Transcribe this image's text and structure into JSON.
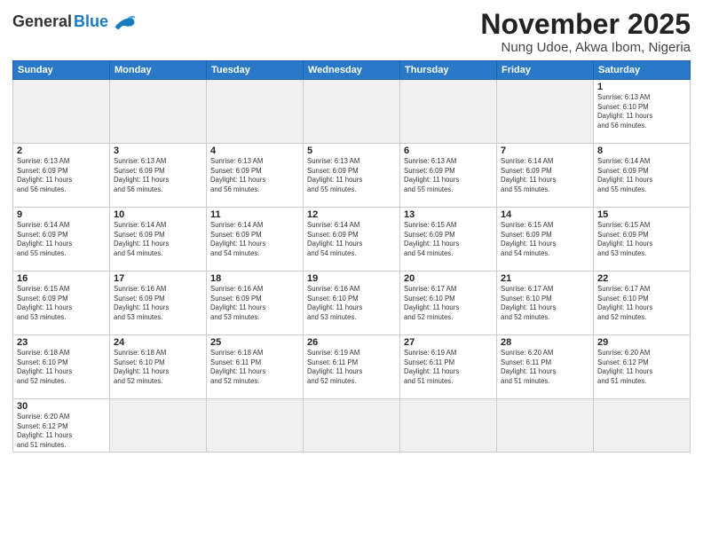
{
  "header": {
    "logo_general": "General",
    "logo_blue": "Blue",
    "month_title": "November 2025",
    "subtitle": "Nung Udoe, Akwa Ibom, Nigeria"
  },
  "weekdays": [
    "Sunday",
    "Monday",
    "Tuesday",
    "Wednesday",
    "Thursday",
    "Friday",
    "Saturday"
  ],
  "days": [
    {
      "date": 1,
      "sunrise": "6:13 AM",
      "sunset": "6:10 PM",
      "daylight": "11 hours and 56 minutes."
    },
    {
      "date": 2,
      "sunrise": "6:13 AM",
      "sunset": "6:09 PM",
      "daylight": "11 hours and 56 minutes."
    },
    {
      "date": 3,
      "sunrise": "6:13 AM",
      "sunset": "6:09 PM",
      "daylight": "11 hours and 56 minutes."
    },
    {
      "date": 4,
      "sunrise": "6:13 AM",
      "sunset": "6:09 PM",
      "daylight": "11 hours and 56 minutes."
    },
    {
      "date": 5,
      "sunrise": "6:13 AM",
      "sunset": "6:09 PM",
      "daylight": "11 hours and 55 minutes."
    },
    {
      "date": 6,
      "sunrise": "6:13 AM",
      "sunset": "6:09 PM",
      "daylight": "11 hours and 55 minutes."
    },
    {
      "date": 7,
      "sunrise": "6:14 AM",
      "sunset": "6:09 PM",
      "daylight": "11 hours and 55 minutes."
    },
    {
      "date": 8,
      "sunrise": "6:14 AM",
      "sunset": "6:09 PM",
      "daylight": "11 hours and 55 minutes."
    },
    {
      "date": 9,
      "sunrise": "6:14 AM",
      "sunset": "6:09 PM",
      "daylight": "11 hours and 55 minutes."
    },
    {
      "date": 10,
      "sunrise": "6:14 AM",
      "sunset": "6:09 PM",
      "daylight": "11 hours and 54 minutes."
    },
    {
      "date": 11,
      "sunrise": "6:14 AM",
      "sunset": "6:09 PM",
      "daylight": "11 hours and 54 minutes."
    },
    {
      "date": 12,
      "sunrise": "6:14 AM",
      "sunset": "6:09 PM",
      "daylight": "11 hours and 54 minutes."
    },
    {
      "date": 13,
      "sunrise": "6:15 AM",
      "sunset": "6:09 PM",
      "daylight": "11 hours and 54 minutes."
    },
    {
      "date": 14,
      "sunrise": "6:15 AM",
      "sunset": "6:09 PM",
      "daylight": "11 hours and 54 minutes."
    },
    {
      "date": 15,
      "sunrise": "6:15 AM",
      "sunset": "6:09 PM",
      "daylight": "11 hours and 53 minutes."
    },
    {
      "date": 16,
      "sunrise": "6:15 AM",
      "sunset": "6:09 PM",
      "daylight": "11 hours and 53 minutes."
    },
    {
      "date": 17,
      "sunrise": "6:16 AM",
      "sunset": "6:09 PM",
      "daylight": "11 hours and 53 minutes."
    },
    {
      "date": 18,
      "sunrise": "6:16 AM",
      "sunset": "6:09 PM",
      "daylight": "11 hours and 53 minutes."
    },
    {
      "date": 19,
      "sunrise": "6:16 AM",
      "sunset": "6:10 PM",
      "daylight": "11 hours and 53 minutes."
    },
    {
      "date": 20,
      "sunrise": "6:17 AM",
      "sunset": "6:10 PM",
      "daylight": "11 hours and 52 minutes."
    },
    {
      "date": 21,
      "sunrise": "6:17 AM",
      "sunset": "6:10 PM",
      "daylight": "11 hours and 52 minutes."
    },
    {
      "date": 22,
      "sunrise": "6:17 AM",
      "sunset": "6:10 PM",
      "daylight": "11 hours and 52 minutes."
    },
    {
      "date": 23,
      "sunrise": "6:18 AM",
      "sunset": "6:10 PM",
      "daylight": "11 hours and 52 minutes."
    },
    {
      "date": 24,
      "sunrise": "6:18 AM",
      "sunset": "6:10 PM",
      "daylight": "11 hours and 52 minutes."
    },
    {
      "date": 25,
      "sunrise": "6:18 AM",
      "sunset": "6:11 PM",
      "daylight": "11 hours and 52 minutes."
    },
    {
      "date": 26,
      "sunrise": "6:19 AM",
      "sunset": "6:11 PM",
      "daylight": "11 hours and 52 minutes."
    },
    {
      "date": 27,
      "sunrise": "6:19 AM",
      "sunset": "6:11 PM",
      "daylight": "11 hours and 51 minutes."
    },
    {
      "date": 28,
      "sunrise": "6:20 AM",
      "sunset": "6:11 PM",
      "daylight": "11 hours and 51 minutes."
    },
    {
      "date": 29,
      "sunrise": "6:20 AM",
      "sunset": "6:12 PM",
      "daylight": "11 hours and 51 minutes."
    },
    {
      "date": 30,
      "sunrise": "6:20 AM",
      "sunset": "6:12 PM",
      "daylight": "11 hours and 51 minutes."
    }
  ],
  "labels": {
    "sunrise": "Sunrise:",
    "sunset": "Sunset:",
    "daylight": "Daylight:"
  }
}
